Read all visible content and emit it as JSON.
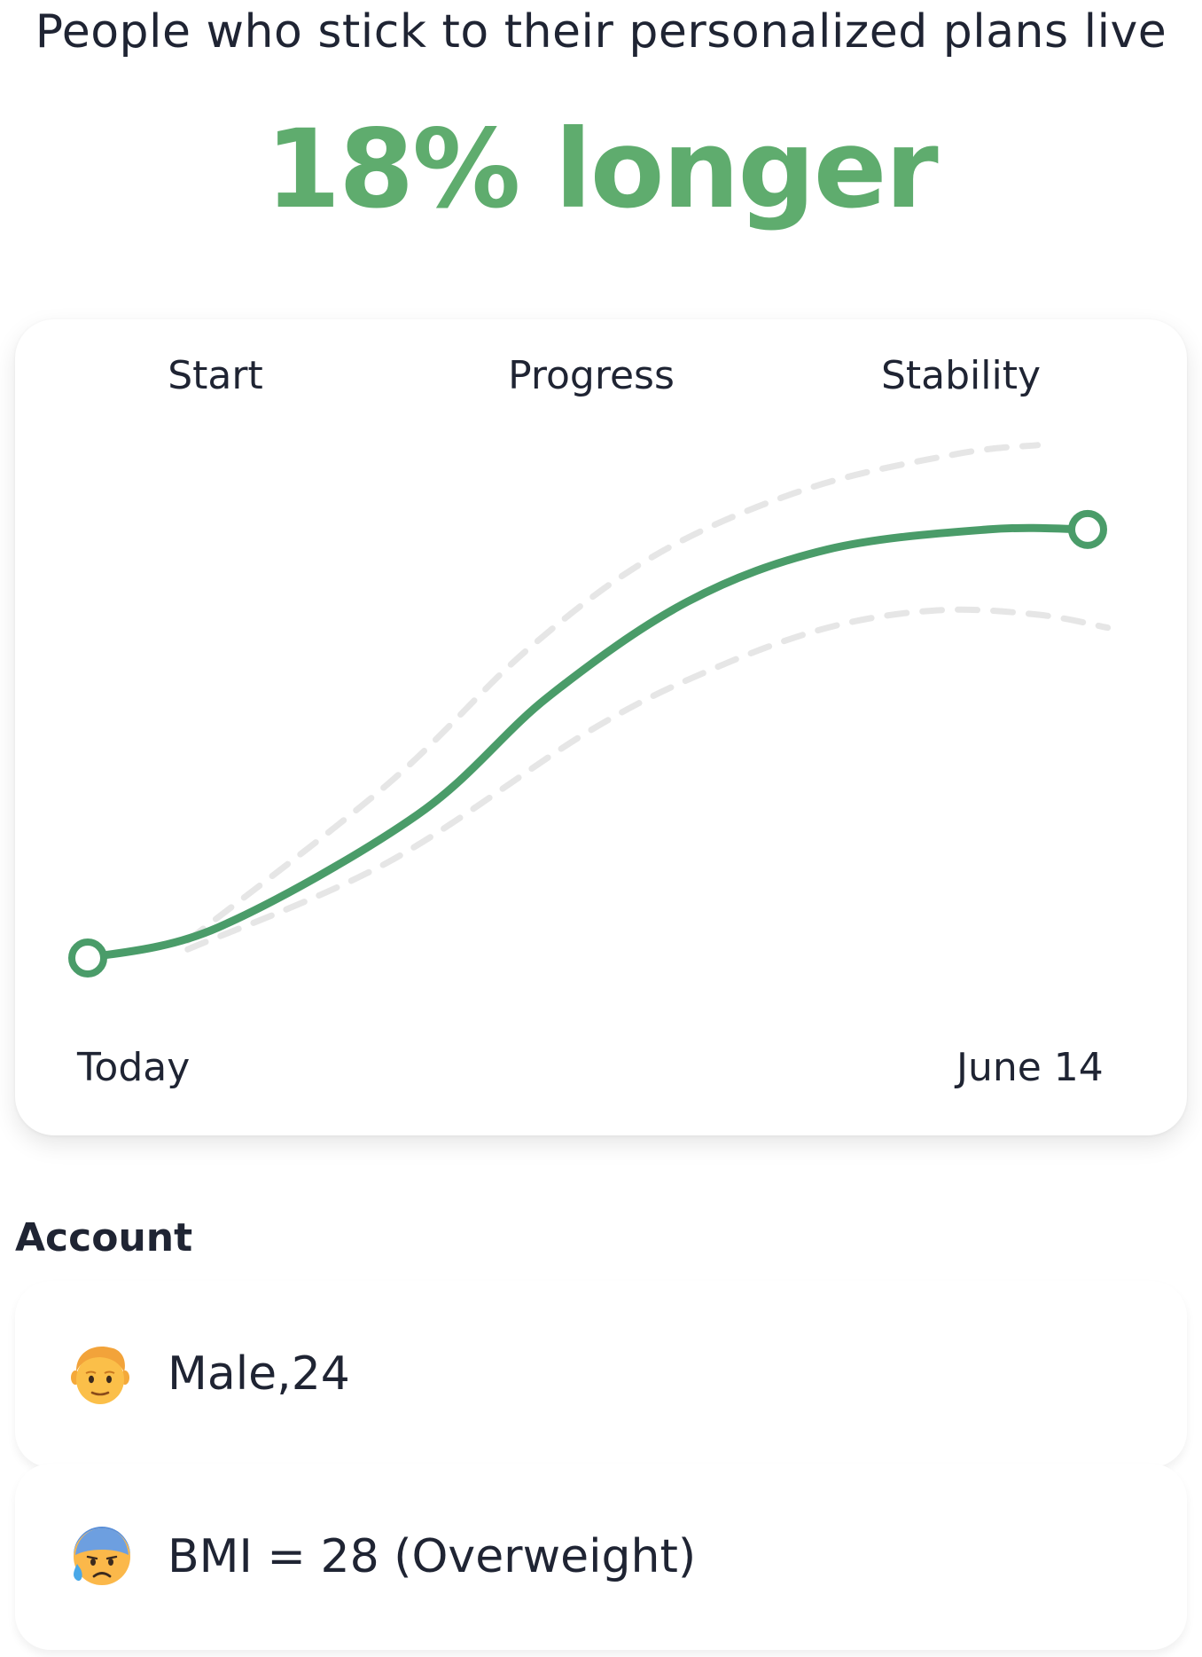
{
  "headline": "People who stick to their personalized plans live",
  "highlight": "18% longer",
  "colors": {
    "accent": "#4a9c69",
    "highlight_text": "#5fac6e",
    "dashed_band": "#e6e6e6",
    "text": "#1f2433"
  },
  "chart_data": {
    "type": "line",
    "phases": [
      "Start",
      "Progress",
      "Stability"
    ],
    "x_start_label": "Today",
    "x_end_label": "June 14",
    "grid": false,
    "series": [
      {
        "role": "main",
        "style": "solid",
        "color": "#4a9c69",
        "x": [
          0,
          0.13,
          0.33,
          0.46,
          0.6,
          0.74,
          0.9,
          1.0
        ],
        "y": [
          0,
          0.07,
          0.33,
          0.6,
          0.82,
          0.94,
          0.986,
          0.986
        ]
      },
      {
        "role": "upper-band",
        "style": "dashed",
        "color": "#e6e6e6",
        "x": [
          0.1,
          0.3,
          0.44,
          0.57,
          0.72,
          0.87,
          0.95
        ],
        "y": [
          0.04,
          0.4,
          0.71,
          0.93,
          1.08,
          1.16,
          1.18
        ]
      },
      {
        "role": "lower-band",
        "style": "dashed",
        "color": "#e6e6e6",
        "x": [
          0.1,
          0.3,
          0.5,
          0.62,
          0.74,
          0.85,
          0.95,
          1.02
        ],
        "y": [
          0.02,
          0.22,
          0.52,
          0.66,
          0.76,
          0.8,
          0.79,
          0.76
        ]
      }
    ]
  },
  "account": {
    "title": "Account",
    "items": [
      {
        "icon": "man-face-icon",
        "label": "Male,24"
      },
      {
        "icon": "anxious-sweat-face-icon",
        "label": "BMI = 28 (Overweight)"
      }
    ]
  }
}
